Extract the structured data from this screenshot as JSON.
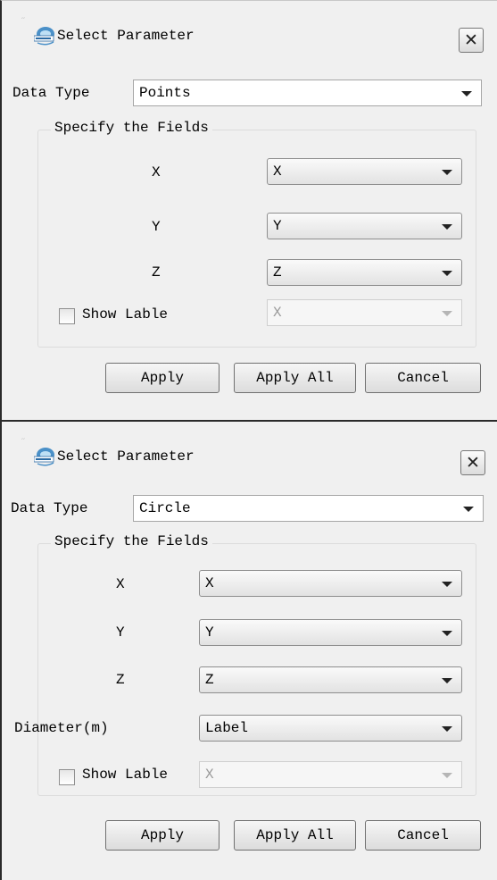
{
  "dialog1": {
    "title": "Select Parameter",
    "data_type_label": "Data Type",
    "data_type_value": "Points",
    "group_title": "Specify the Fields",
    "fields": [
      {
        "label": "X",
        "value": "X"
      },
      {
        "label": "Y",
        "value": "Y"
      },
      {
        "label": "Z",
        "value": "Z"
      }
    ],
    "show_label_text": "Show Lable",
    "show_label_checked": false,
    "show_label_value": "X",
    "buttons": {
      "apply": "Apply",
      "apply_all": "Apply All",
      "cancel": "Cancel"
    }
  },
  "dialog2": {
    "title": "Select Parameter",
    "data_type_label": "Data Type",
    "data_type_value": "Circle",
    "group_title": "Specify the Fields",
    "fields": [
      {
        "label": "X",
        "value": "X"
      },
      {
        "label": "Y",
        "value": "Y"
      },
      {
        "label": "Z",
        "value": "Z"
      },
      {
        "label": "Diameter(m)",
        "value": "Label"
      }
    ],
    "show_label_text": "Show Lable",
    "show_label_checked": false,
    "show_label_value": "X",
    "buttons": {
      "apply": "Apply",
      "apply_all": "Apply All",
      "cancel": "Cancel"
    }
  },
  "icons": {
    "app": "app-logo-icon",
    "close": "close-icon",
    "dropdown": "chevron-down-icon"
  }
}
